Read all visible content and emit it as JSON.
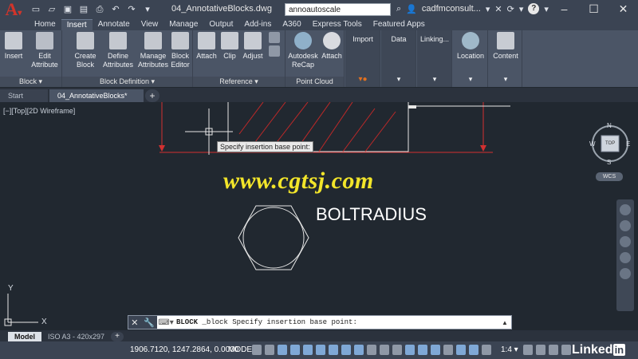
{
  "titlebar": {
    "document_title": "04_AnnotativeBlocks.dwg",
    "search_value": "annoautoscale",
    "account": "cadfmconsult...",
    "help": "?",
    "minimize": "–",
    "maximize": "☐",
    "close": "✕"
  },
  "ribbon_tabs": [
    "Home",
    "Insert",
    "Annotate",
    "View",
    "Manage",
    "Output",
    "Add-ins",
    "A360",
    "Express Tools",
    "Featured Apps"
  ],
  "ribbon": {
    "block_panel": {
      "title": "Block ▾",
      "insert": "Insert",
      "edit_attribute": "Edit Attribute"
    },
    "block_def_panel": {
      "title": "Block Definition ▾",
      "create_block": "Create Block",
      "define_attributes": "Define Attributes",
      "manage_attributes": "Manage Attributes",
      "block_editor": "Block Editor"
    },
    "reference_panel": {
      "title": "Reference ▾",
      "attach": "Attach",
      "clip": "Clip",
      "adjust": "Adjust"
    },
    "point_cloud_panel": {
      "title": "Point Cloud",
      "recap": "Autodesk ReCap",
      "attach": "Attach"
    },
    "import_panel": {
      "title": "Import"
    },
    "data_panel": {
      "title": "Data"
    },
    "linking_panel": {
      "title": "Linking..."
    },
    "location_panel": {
      "title": "Location"
    },
    "content_panel": {
      "title": "Content"
    }
  },
  "file_tabs": {
    "start": "Start",
    "active": "04_AnnotativeBlocks*",
    "add": "+"
  },
  "viewport": {
    "label": "[−][Top][2D Wireframe]",
    "tooltip": "Specify insertion base point:",
    "watermark": "www.cgtsj.com",
    "bolt_label": "BOLTRADIUS",
    "viewcube": {
      "top": "TOP",
      "n": "N",
      "s": "S",
      "e": "E",
      "w": "W",
      "wcs": "WCS"
    },
    "ucs": {
      "x": "X",
      "y": "Y"
    }
  },
  "command_line": {
    "command": "BLOCK",
    "text": "_block Specify insertion base point:"
  },
  "layout_tabs": {
    "model": "Model",
    "layout": "ISO A3 - 420x297",
    "add": "+"
  },
  "status_bar": {
    "coordinates": "1906.7120, 1247.2864, 0.0000",
    "model": "MODEL",
    "scale": "1:4 ▾",
    "brand": "Linked",
    "brand_in": "in"
  },
  "colors": {
    "accent": "#d2342a",
    "canvas": "#212830",
    "ribbon": "#4b5566",
    "watermark": "#f2e52a"
  }
}
